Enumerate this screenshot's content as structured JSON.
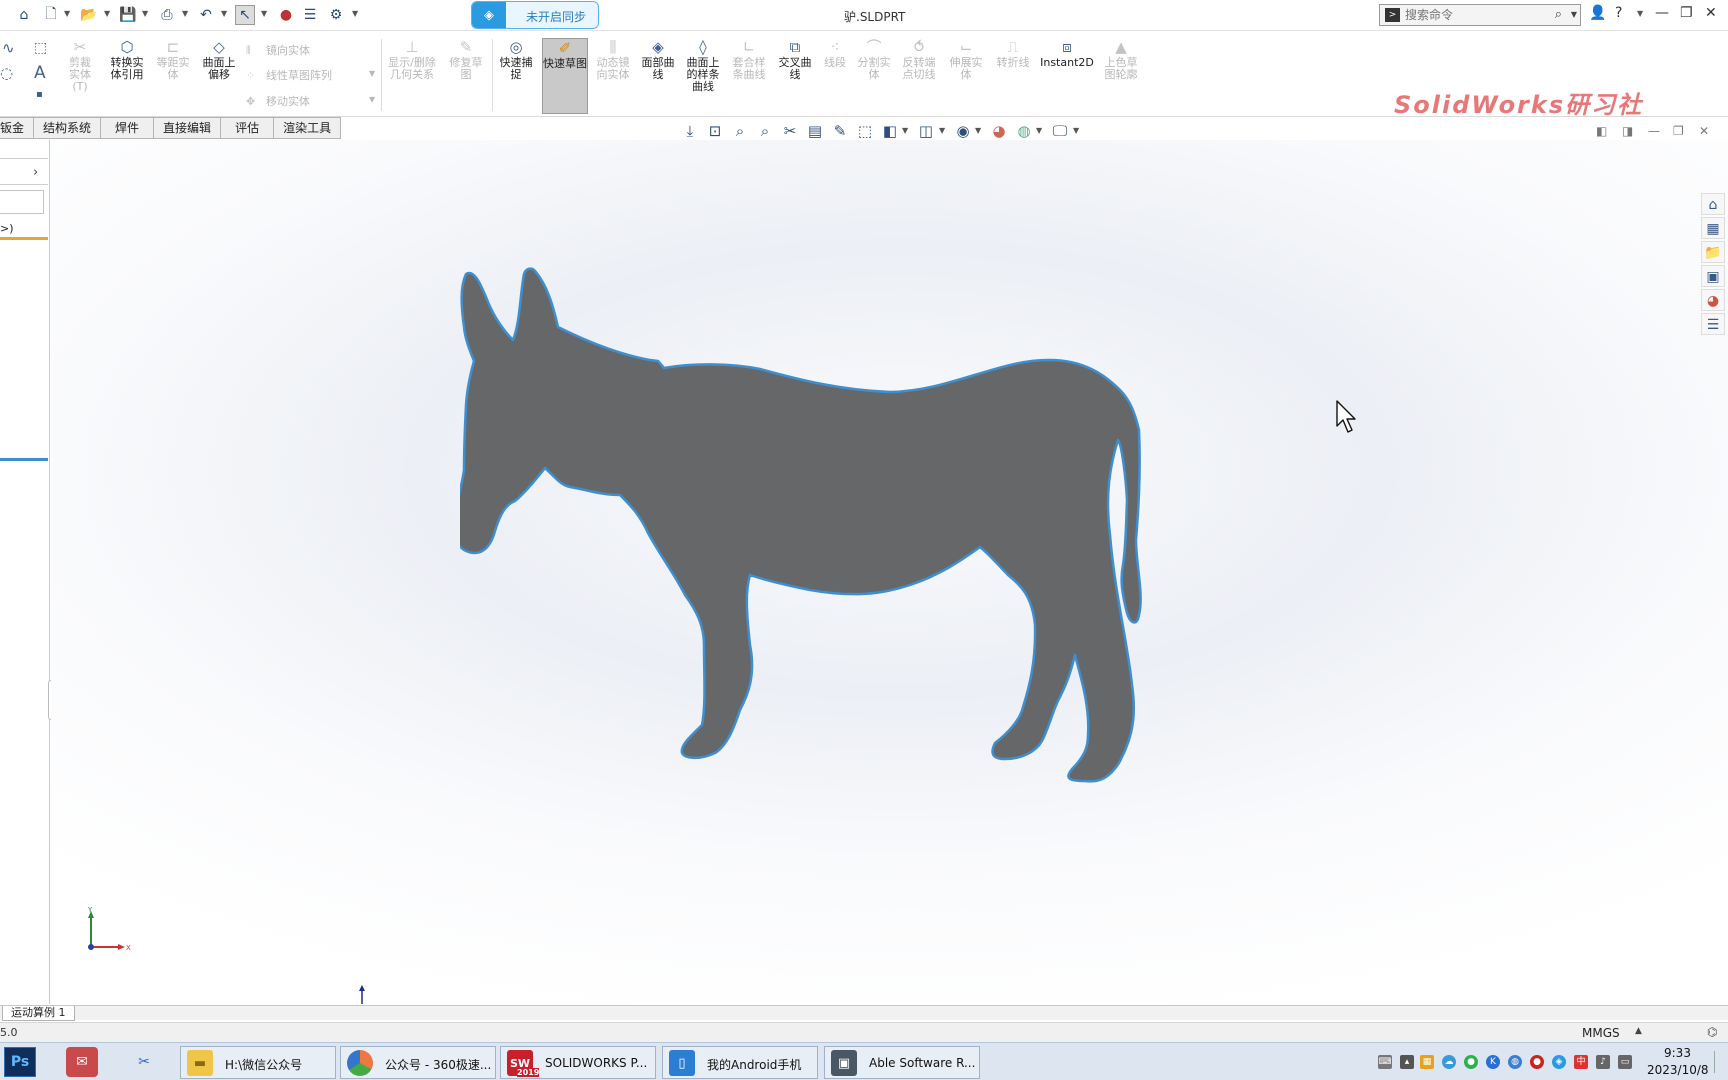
{
  "window": {
    "document_title": "驴.SLDPRT",
    "sync_label": "未开启同步",
    "search_placeholder": "搜索命令"
  },
  "watermark": "SolidWorks研习社",
  "commands": {
    "trim_entities": "剪裁实体(T)",
    "convert_entities": "转换实体引用",
    "offset_entities": "等距实体",
    "offset_on_surface": "曲面上偏移",
    "mirror_entities": "镜向实体",
    "linear_sketch_pattern": "线性草图阵列",
    "move_entities": "移动实体",
    "display_delete_relations": "显示/删除几何关系",
    "repair_sketch": "修复草图",
    "quick_snaps": "快速捕捉",
    "rapid_sketch": "快速草图",
    "dynamic_mirror": "动态镜向实体",
    "face_curves": "面部曲线",
    "spline_on_surface": "曲面上的样条曲线",
    "fit_spline": "套合样条曲线",
    "intersection_curve": "交叉曲线",
    "segment": "线段",
    "split_entities": "分割实体",
    "reverse_endpoint_tangent": "反转端点切线",
    "stretch_entities": "伸展实体",
    "jog_line": "转折线",
    "instant2d": "Instant2D",
    "shaded_sketch_contours": "上色草图轮廓"
  },
  "tabs": [
    "钣金",
    "结构系统",
    "焊件",
    "直接编辑",
    "评估",
    "渲染工具"
  ],
  "left_panel": {
    "tree_fragment": ">)"
  },
  "triad": {
    "y": "Y",
    "x": "X"
  },
  "bottom_tab": "运动算例 1",
  "status": {
    "left_text": "5.0",
    "units": "MMGS"
  },
  "taskbar": {
    "tasks": [
      {
        "label": "H:\\微信公众号",
        "icon": "folder-icon"
      },
      {
        "label": "公众号 - 360极速...",
        "icon": "browser-icon"
      },
      {
        "label": "SOLIDWORKS P...",
        "icon": "solidworks-icon",
        "badge": "2019"
      },
      {
        "label": "我的Android手机",
        "icon": "phone-icon"
      },
      {
        "label": "Able Software R...",
        "icon": "able-software-icon"
      }
    ],
    "ps_label": "Ps",
    "clock_time": "9:33",
    "clock_date": "2023/10/8"
  },
  "colors": {
    "silhouette_fill": "#666769",
    "silhouette_edge": "#3f8fcf",
    "accent_blue": "#2a9be0",
    "watermark": "#e87878"
  }
}
